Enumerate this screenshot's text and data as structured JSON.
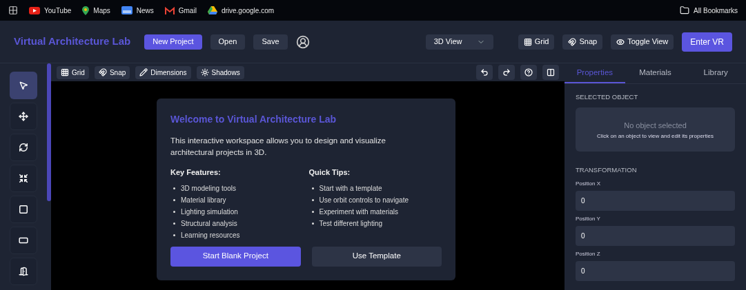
{
  "bookmarks": [
    {
      "label": "YouTube",
      "kind": "youtube"
    },
    {
      "label": "Maps",
      "kind": "maps"
    },
    {
      "label": "News",
      "kind": "news"
    },
    {
      "label": "Gmail",
      "kind": "gmail"
    },
    {
      "label": "drive.google.com",
      "kind": "drive"
    }
  ],
  "all_bookmarks": "All Bookmarks",
  "header": {
    "title": "Virtual Architecture Lab",
    "buttons": [
      {
        "label": "New Project",
        "kind": "primary"
      },
      {
        "label": "Open",
        "kind": "secondary"
      },
      {
        "label": "Save",
        "kind": "secondary"
      }
    ],
    "view_select": "3D View",
    "toggles": [
      {
        "label": "Grid",
        "kind": "grid"
      },
      {
        "label": "Snap",
        "kind": "magnet"
      },
      {
        "label": "Toggle View",
        "kind": "eye"
      }
    ],
    "enter_vr": "Enter VR"
  },
  "tools": [
    {
      "kind": "pointer",
      "selected": true
    },
    {
      "kind": "move",
      "selected": false
    },
    {
      "kind": "rotate",
      "selected": false
    },
    {
      "kind": "scale",
      "selected": false
    },
    {
      "kind": "square",
      "selected": false
    },
    {
      "kind": "window",
      "selected": false
    },
    {
      "kind": "door",
      "selected": false
    }
  ],
  "canvas_toolbar": [
    {
      "label": "Grid",
      "kind": "grid"
    },
    {
      "label": "Snap",
      "kind": "magnet"
    },
    {
      "label": "Dimensions",
      "kind": "pencil"
    },
    {
      "label": "Shadows",
      "kind": "sun"
    }
  ],
  "canvas_actions": [
    {
      "kind": "undo"
    },
    {
      "kind": "redo"
    },
    {
      "kind": "help"
    },
    {
      "kind": "columns"
    }
  ],
  "welcome": {
    "title": "Welcome to Virtual Architecture Lab",
    "text": "This interactive workspace allows you to design and visualize architectural projects in 3D.",
    "columns": [
      {
        "heading": "Key Features:",
        "items": [
          "3D modeling tools",
          "Material library",
          "Lighting simulation",
          "Structural analysis",
          "Learning resources"
        ]
      },
      {
        "heading": "Quick Tips:",
        "items": [
          "Start with a template",
          "Use orbit controls to navigate",
          "Experiment with materials",
          "Test different lighting"
        ]
      }
    ],
    "buttons": [
      {
        "label": "Start Blank Project",
        "kind": "primary"
      },
      {
        "label": "Use Template",
        "kind": "secondary"
      }
    ]
  },
  "tabs": [
    {
      "label": "Properties",
      "selected": true
    },
    {
      "label": "Materials",
      "selected": false
    },
    {
      "label": "Library",
      "selected": false
    }
  ],
  "panel": {
    "selected_heading": "SELECTED OBJECT",
    "empty_title": "No object selected",
    "empty_text": "Click on an object to view and edit its properties",
    "transform_heading": "TRANSFORMATION",
    "fields": [
      {
        "label": "Position X",
        "value": "0"
      },
      {
        "label": "Position Y",
        "value": "0"
      },
      {
        "label": "Position Z",
        "value": "0"
      }
    ]
  }
}
